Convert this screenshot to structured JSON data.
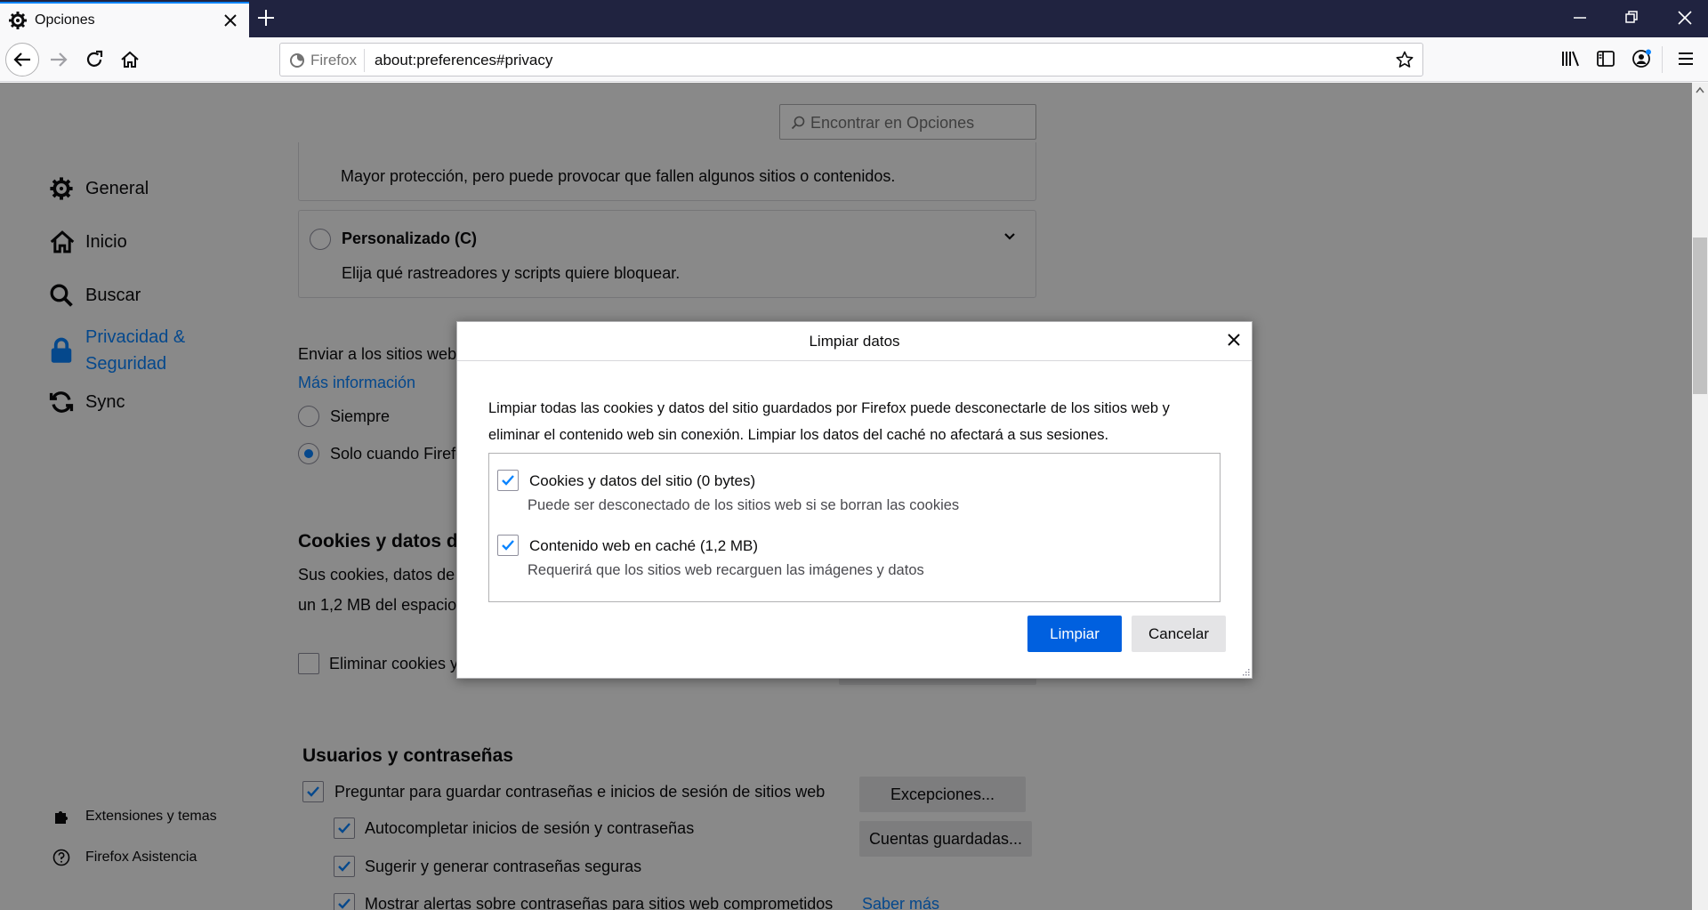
{
  "window": {
    "tab_title": "Opciones",
    "new_tab_icon": "plus-icon"
  },
  "toolbar": {
    "identity_label": "Firefox",
    "url": "about:preferences#privacy"
  },
  "search": {
    "placeholder": "Encontrar en Opciones"
  },
  "sidebar": {
    "items": [
      {
        "label": "General",
        "icon": "gear-icon"
      },
      {
        "label": "Inicio",
        "icon": "home-icon"
      },
      {
        "label": "Buscar",
        "icon": "search-icon"
      },
      {
        "label": "Privacidad &",
        "label2": "Seguridad",
        "icon": "lock-icon"
      },
      {
        "label": "Sync",
        "icon": "sync-icon"
      }
    ],
    "footer": [
      {
        "label": "Extensiones y temas",
        "icon": "puzzle-icon"
      },
      {
        "label": "Firefox Asistencia",
        "icon": "help-icon"
      }
    ]
  },
  "main": {
    "strict_desc": "Mayor protección, pero puede provocar que fallen algunos sitios o contenidos.",
    "custom_title": "Personalizado (C)",
    "custom_desc": "Elija qué rastreadores y scripts quiere bloquear.",
    "dnt_text": "Enviar a los sitios web",
    "dnt_link": "Más información",
    "dnt_always": "Siempre",
    "dnt_only": "Solo cuando Firefox",
    "cookies_heading": "Cookies y datos de",
    "cookies_text1": "Sus cookies, datos de",
    "cookies_text2": "un 1,2 MB del espacio",
    "cookies_delete": "Eliminar cookies y",
    "users_heading": "Usuarios y contraseñas",
    "ask_save": "Preguntar para guardar contraseñas e inicios de sesión de sitios web",
    "exceptions_btn": "Excepciones...",
    "autofill": "Autocompletar inicios de sesión y contraseñas",
    "saved_btn": "Cuentas guardadas...",
    "suggest": "Sugerir y generar contraseñas seguras",
    "alerts": "Mostrar alertas sobre contraseñas para sitios web comprometidos",
    "alerts_link": "Saber más"
  },
  "dialog": {
    "title": "Limpiar datos",
    "description": "Limpiar todas las cookies y datos del sitio guardados por Firefox puede desconectarle de los sitios web y eliminar el contenido web sin conexión. Limpiar los datos del caché no afectará a sus sesiones.",
    "options": [
      {
        "label": "Cookies y datos del sitio (0 bytes)",
        "desc": "Puede ser desconectado de los sitios web si se borran las cookies",
        "checked": true
      },
      {
        "label": "Contenido web en caché (1,2 MB)",
        "desc": "Requerirá que los sitios web recarguen las imágenes y datos",
        "checked": true
      }
    ],
    "clear_label": "Limpiar",
    "cancel_label": "Cancelar"
  },
  "colors": {
    "accent": "#0a84ff",
    "primary_button": "#0060df",
    "titlebar": "#202340"
  }
}
